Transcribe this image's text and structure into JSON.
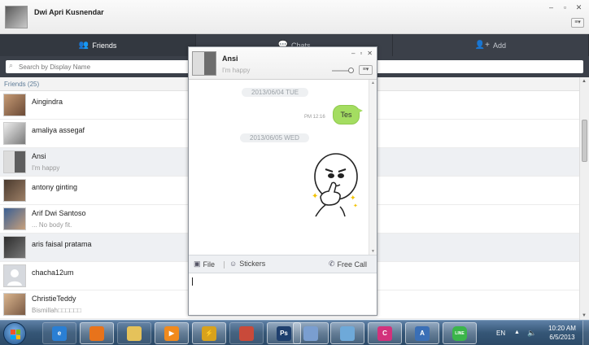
{
  "app": {
    "user_name": "Dwi Apri Kusnendar",
    "window_controls": [
      "–",
      "▫",
      "✕"
    ],
    "menu_icon": "≡▾"
  },
  "tabs": [
    {
      "label": "Friends",
      "icon": "people-icon",
      "active": true
    },
    {
      "label": "Chats",
      "icon": "chat-bubble-icon",
      "active": false
    },
    {
      "label": "Add",
      "icon": "add-person-icon",
      "active": false
    }
  ],
  "search": {
    "placeholder": "Search by Display Name"
  },
  "friends": {
    "header": "Friends (25)",
    "items": [
      {
        "name": "Aingindra",
        "status": ""
      },
      {
        "name": "amaliya assegaf",
        "status": ""
      },
      {
        "name": "Ansi",
        "status": "I'm happy"
      },
      {
        "name": "antony ginting",
        "status": ""
      },
      {
        "name": "Arif Dwi Santoso",
        "status": "... No body fit."
      },
      {
        "name": "aris faisal pratama",
        "status": ""
      },
      {
        "name": "chacha12um",
        "status": ""
      },
      {
        "name": "ChristieTeddy",
        "status": "Bismillah□□□□□□"
      }
    ]
  },
  "chat": {
    "name": "Ansi",
    "status": "I'm happy",
    "messages": [
      {
        "type": "date",
        "text": "2013/06/04 TUE"
      },
      {
        "type": "sent",
        "time": "PM 12:16",
        "text": "Tes"
      },
      {
        "type": "date",
        "text": "2013/06/05 WED"
      },
      {
        "type": "sticker",
        "sticker": "thumbs-up-character-sticker"
      }
    ],
    "tools": {
      "file": "File",
      "stickers": "Stickers",
      "free_call": "Free Call"
    },
    "input_value": ""
  },
  "taskbar": {
    "language": "EN",
    "time": "10:20 AM",
    "date": "6/5/2013",
    "apps": [
      {
        "name": "internet-explorer-icon",
        "color": "#2a7fd4",
        "glyph": "e"
      },
      {
        "name": "firefox-icon",
        "color": "#e8731b",
        "glyph": ""
      },
      {
        "name": "file-explorer-icon",
        "color": "#e5c25a",
        "glyph": ""
      },
      {
        "name": "media-player-icon",
        "color": "#f18a1d",
        "glyph": "▶"
      },
      {
        "name": "winamp-icon",
        "color": "#d8a21c",
        "glyph": "⚡"
      },
      {
        "name": "chrome-icon",
        "color": "#c94a3a",
        "glyph": ""
      },
      {
        "name": "photoshop-icon",
        "color": "#1e3f6e",
        "glyph": "Ps"
      },
      {
        "name": "paint-icon",
        "color": "#7a9ed0",
        "glyph": ""
      },
      {
        "name": "document-icon",
        "color": "#6ea9d9",
        "glyph": ""
      },
      {
        "name": "corel-icon",
        "color": "#d2327c",
        "glyph": "C"
      },
      {
        "name": "word-icon",
        "color": "#3a6fb6",
        "glyph": "A"
      },
      {
        "name": "line-icon",
        "color": "#3bb54a",
        "glyph": "LINE"
      }
    ]
  },
  "colors": {
    "bubble_green": "#a4dd61",
    "tab_bar": "#3b4049",
    "friends_header_text": "#5d7b97"
  }
}
